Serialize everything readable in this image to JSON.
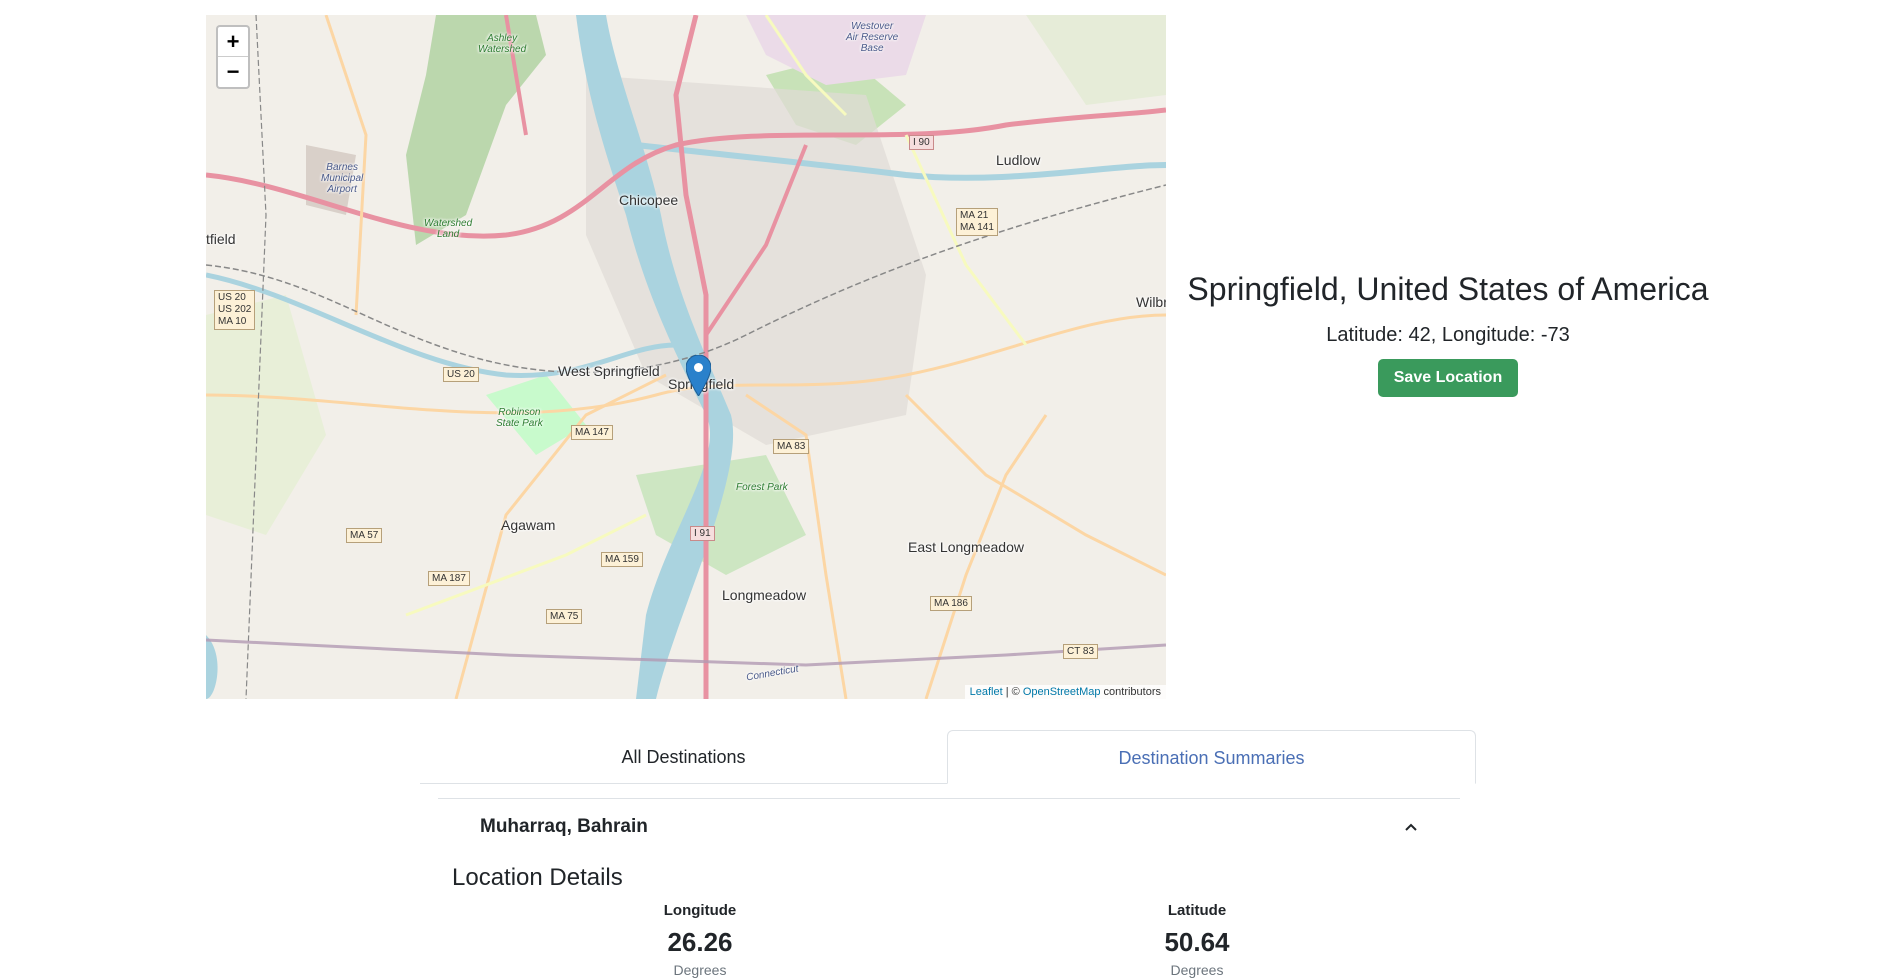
{
  "map": {
    "zoom_in": "+",
    "zoom_out": "−",
    "attribution": {
      "leaflet": "Leaflet",
      "sep": " | © ",
      "osm": "OpenStreetMap",
      "suffix": " contributors"
    },
    "places": {
      "chicopee": "Chicopee",
      "ludlow": "Ludlow",
      "west_springfield": "West Springfield",
      "springfield": "Springfield",
      "agawam": "Agawam",
      "east_longmeadow": "East Longmeadow",
      "longmeadow": "Longmeadow",
      "westfield": "tfield",
      "wilbraham": "Wilbr"
    },
    "parks": {
      "ashley": "Ashley\nWatershed",
      "watershed_land": "Watershed\nLand",
      "robinson": "Robinson\nState Park",
      "forest_park": "Forest Park",
      "westover": "Westover\nAir Reserve\nBase",
      "barnes": "Barnes\nMunicipal\nAirport",
      "connecticut": "Connecticut"
    },
    "shields": {
      "i90": "I 90",
      "ma21": "MA 21\nMA 141",
      "us20_multi": "US 20\nUS 202\nMA 10",
      "us20": "US 20",
      "ma147": "MA 147",
      "ma83": "MA 83",
      "ma57": "MA 57",
      "i91": "I 91",
      "ma159": "MA 159",
      "ma187": "MA 187",
      "ma75": "MA 75",
      "ma186": "MA 186",
      "ct83": "CT 83"
    }
  },
  "location": {
    "title": "Springfield, United States of America",
    "coords": "Latitude: 42, Longitude: -73",
    "save_label": "Save Location"
  },
  "tabs": [
    {
      "label": "All Destinations",
      "active": false
    },
    {
      "label": "Destination Summaries",
      "active": true
    }
  ],
  "summary": {
    "destination": "Muharraq, Bahrain",
    "section_title": "Location Details",
    "longitude": {
      "label": "Longitude",
      "value": "26.26",
      "unit": "Degrees"
    },
    "latitude": {
      "label": "Latitude",
      "value": "50.64",
      "unit": "Degrees"
    }
  },
  "colors": {
    "save_button": "#3a9a5c",
    "active_tab": "#4a6fb5",
    "marker": "#2a81cb",
    "river": "#aad3df",
    "motorway": "#e892a2"
  }
}
